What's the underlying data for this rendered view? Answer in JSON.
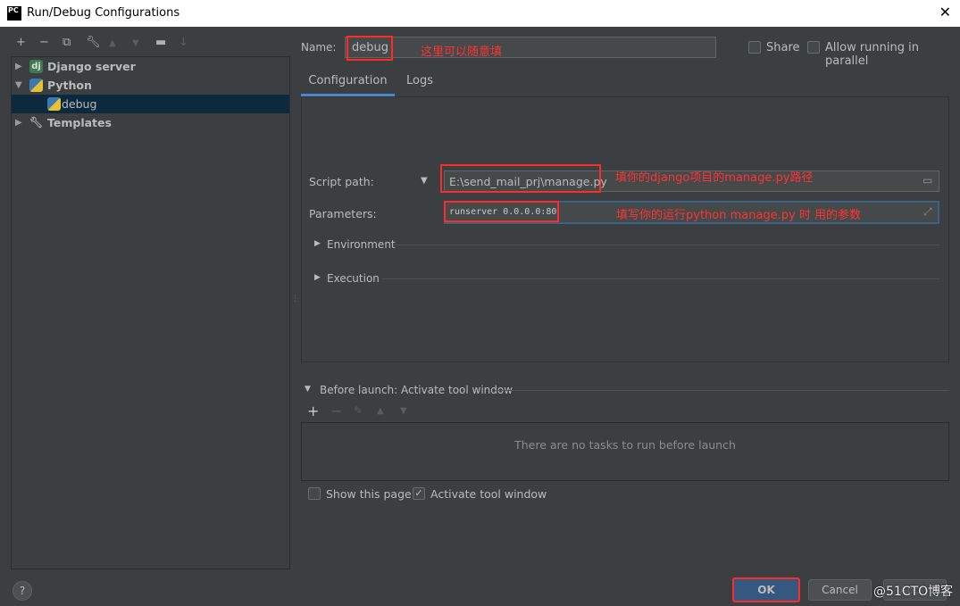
{
  "window": {
    "title": "Run/Debug Configurations",
    "logo": "PC"
  },
  "tree": {
    "items": [
      {
        "label": "Django server",
        "icon": "dj"
      },
      {
        "label": "Python"
      },
      {
        "label": "debug"
      },
      {
        "label": "Templates"
      }
    ]
  },
  "name": {
    "label": "Name:",
    "value": "debug",
    "annotation": "这里可以随意填"
  },
  "share": {
    "label": "Share",
    "checked": false
  },
  "parallel": {
    "label": "Allow running in parallel",
    "checked": false
  },
  "tabs": [
    "Configuration",
    "Logs"
  ],
  "script": {
    "label": "Script path:",
    "value": "E:\\send_mail_prj\\manage.py",
    "annotation": "填你的django项目的manage.py路径"
  },
  "params": {
    "label": "Parameters:",
    "value": "runserver 0.0.0.0:80",
    "annotation": "填写你的运行python manage.py 时 用的参数"
  },
  "sections": [
    "Environment",
    "Execution"
  ],
  "before_launch": {
    "title": "Before launch: Activate tool window",
    "empty": "There are no tasks to run before launch"
  },
  "show_page": {
    "label": "Show this page",
    "checked": false
  },
  "activate": {
    "label": "Activate tool window",
    "checked": true
  },
  "buttons": {
    "ok": "OK",
    "cancel": "Cancel",
    "apply": "Apply",
    "help": "?"
  },
  "watermark": "@51CTO博客"
}
